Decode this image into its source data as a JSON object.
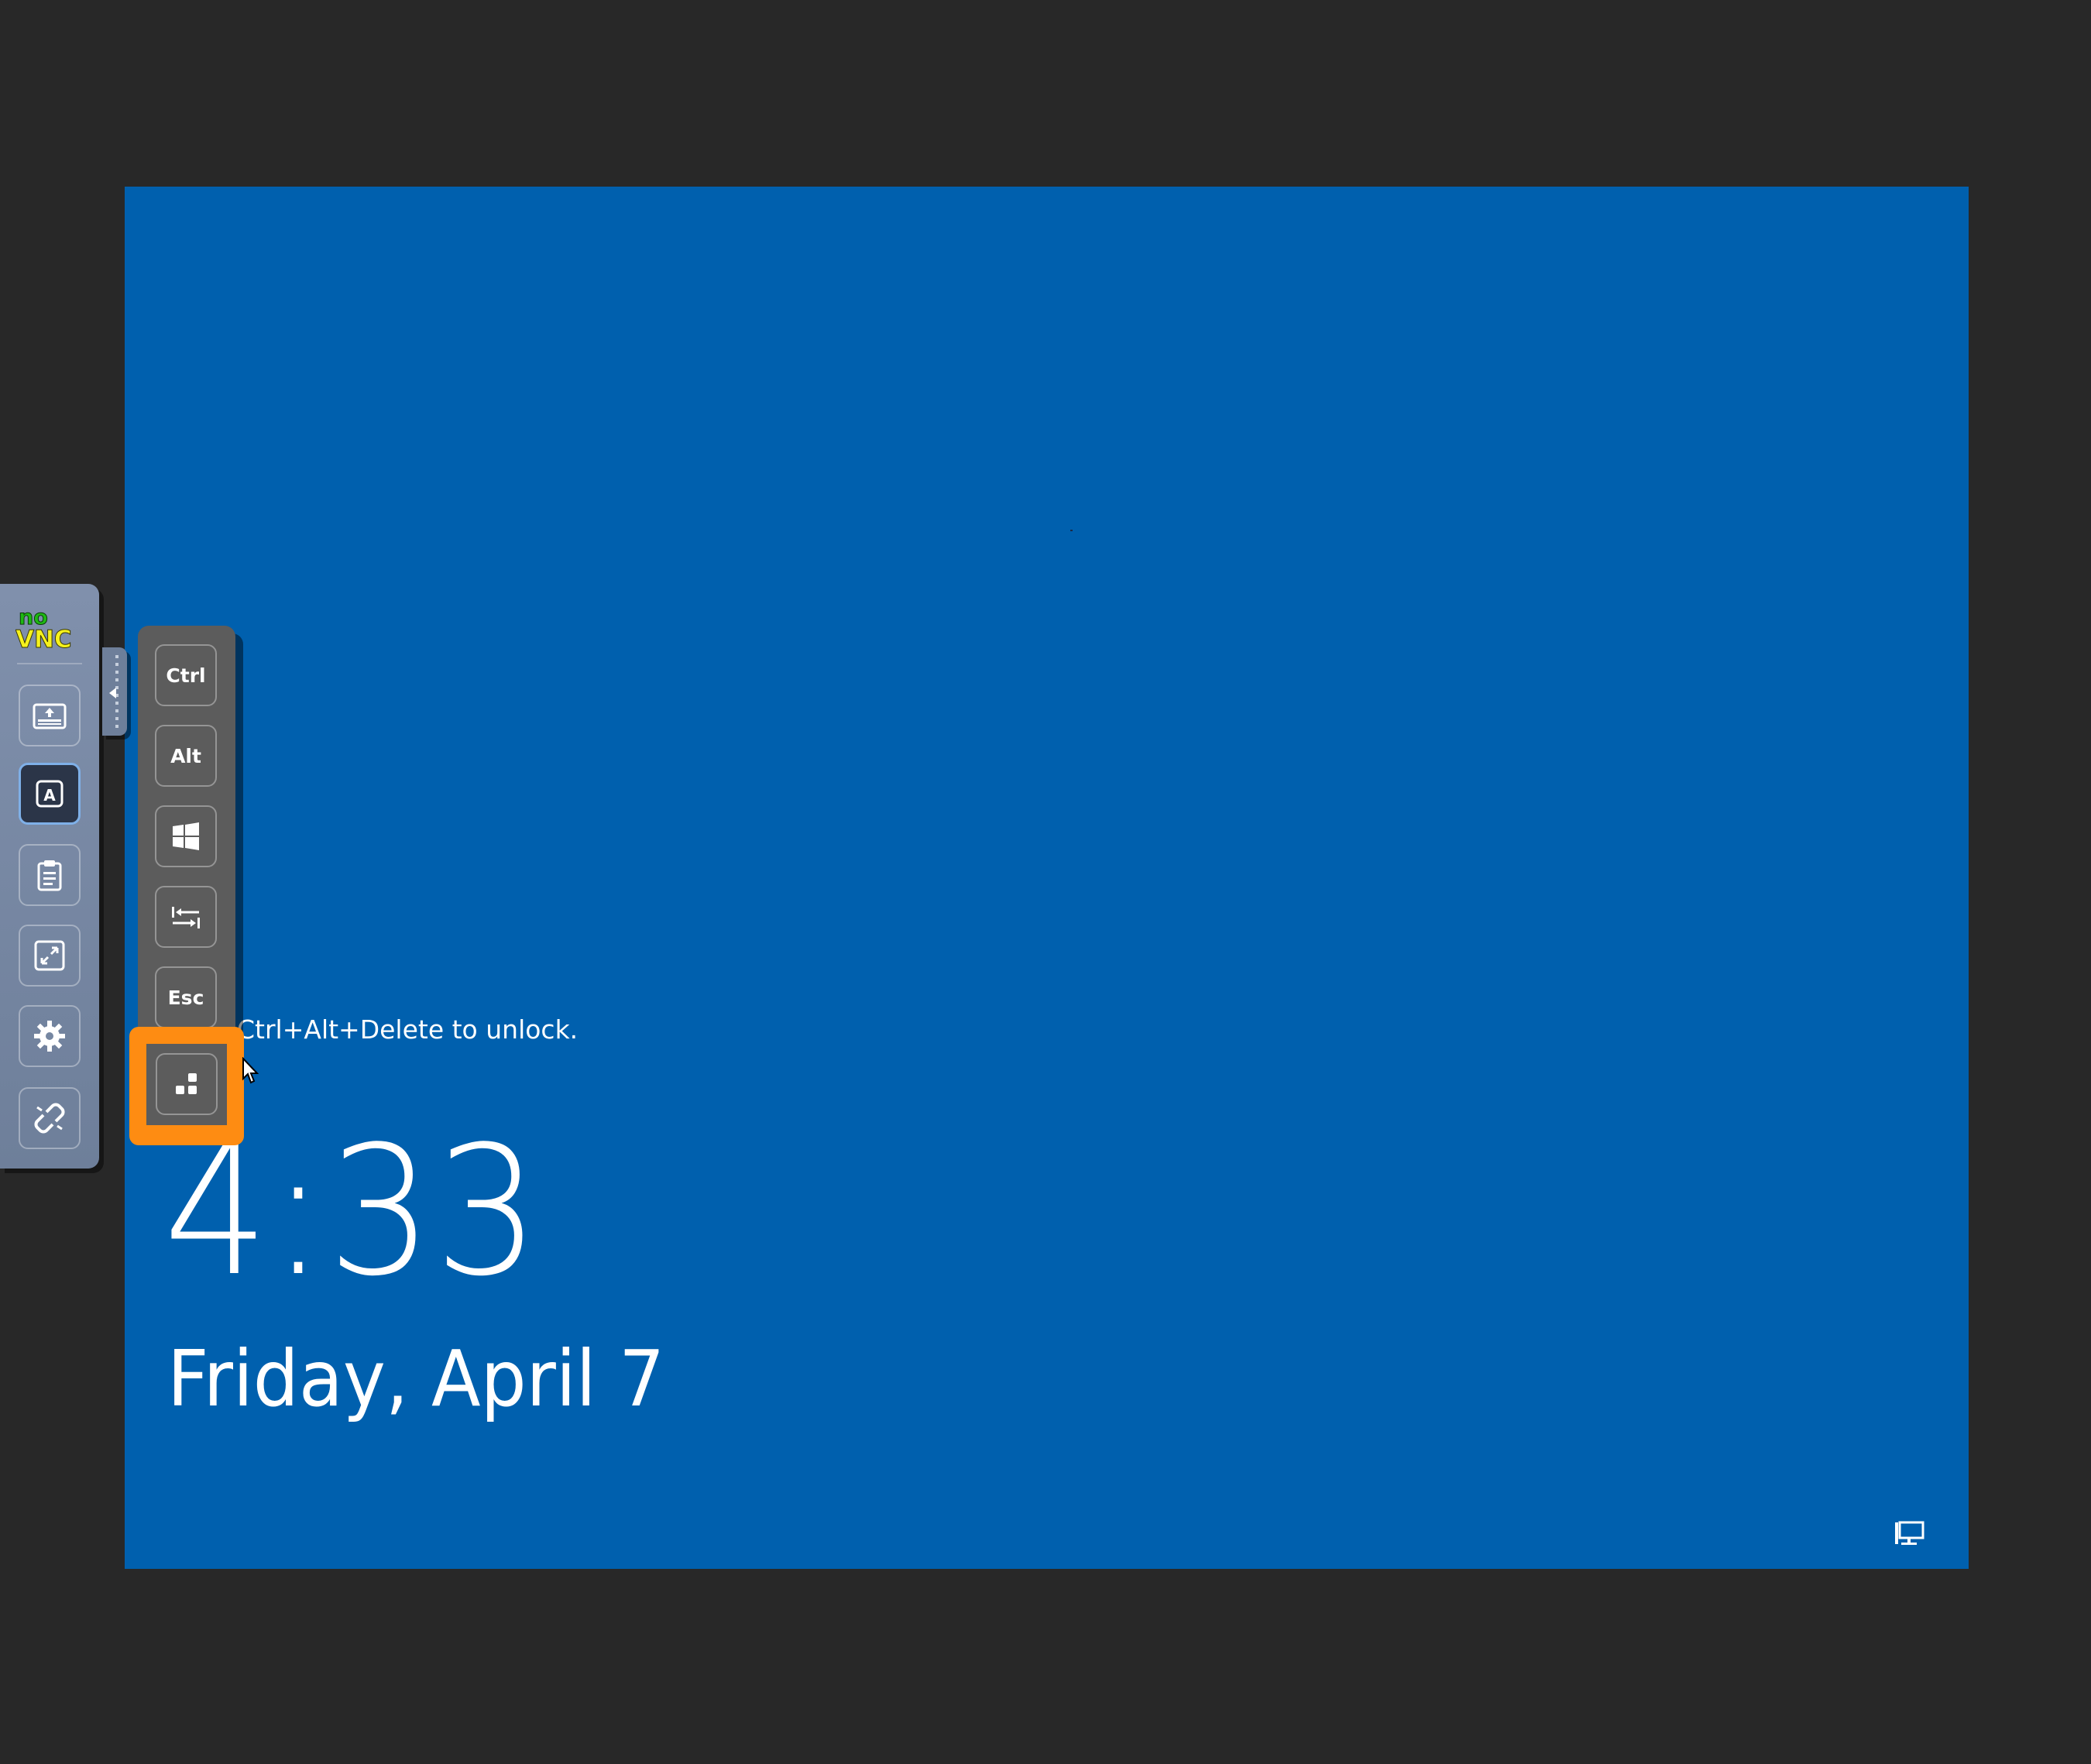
{
  "lock_screen": {
    "unlock_message": "Ctrl+Alt+Delete to unlock.",
    "time": "4:33",
    "date": "Friday, April 7",
    "background_color": "#0060ae"
  },
  "control_bar": {
    "logo": {
      "line1": "no",
      "line2": "VNC"
    },
    "buttons": [
      {
        "name": "keyboard-icon"
      },
      {
        "name": "extra-keys-icon",
        "active": true
      },
      {
        "name": "clipboard-icon"
      },
      {
        "name": "fullscreen-icon"
      },
      {
        "name": "settings-icon"
      },
      {
        "name": "disconnect-icon"
      }
    ]
  },
  "extra_keys": {
    "ctrl_label": "Ctrl",
    "alt_label": "Alt",
    "windows_icon": "windows-icon",
    "tab_icon": "tab-icon",
    "esc_label": "Esc",
    "ctrl_alt_del_icon": "ctrl-alt-del-icon"
  },
  "colors": {
    "highlight": "#fe8c12",
    "panel": "#5c5c5c",
    "backdrop": "#282828"
  }
}
